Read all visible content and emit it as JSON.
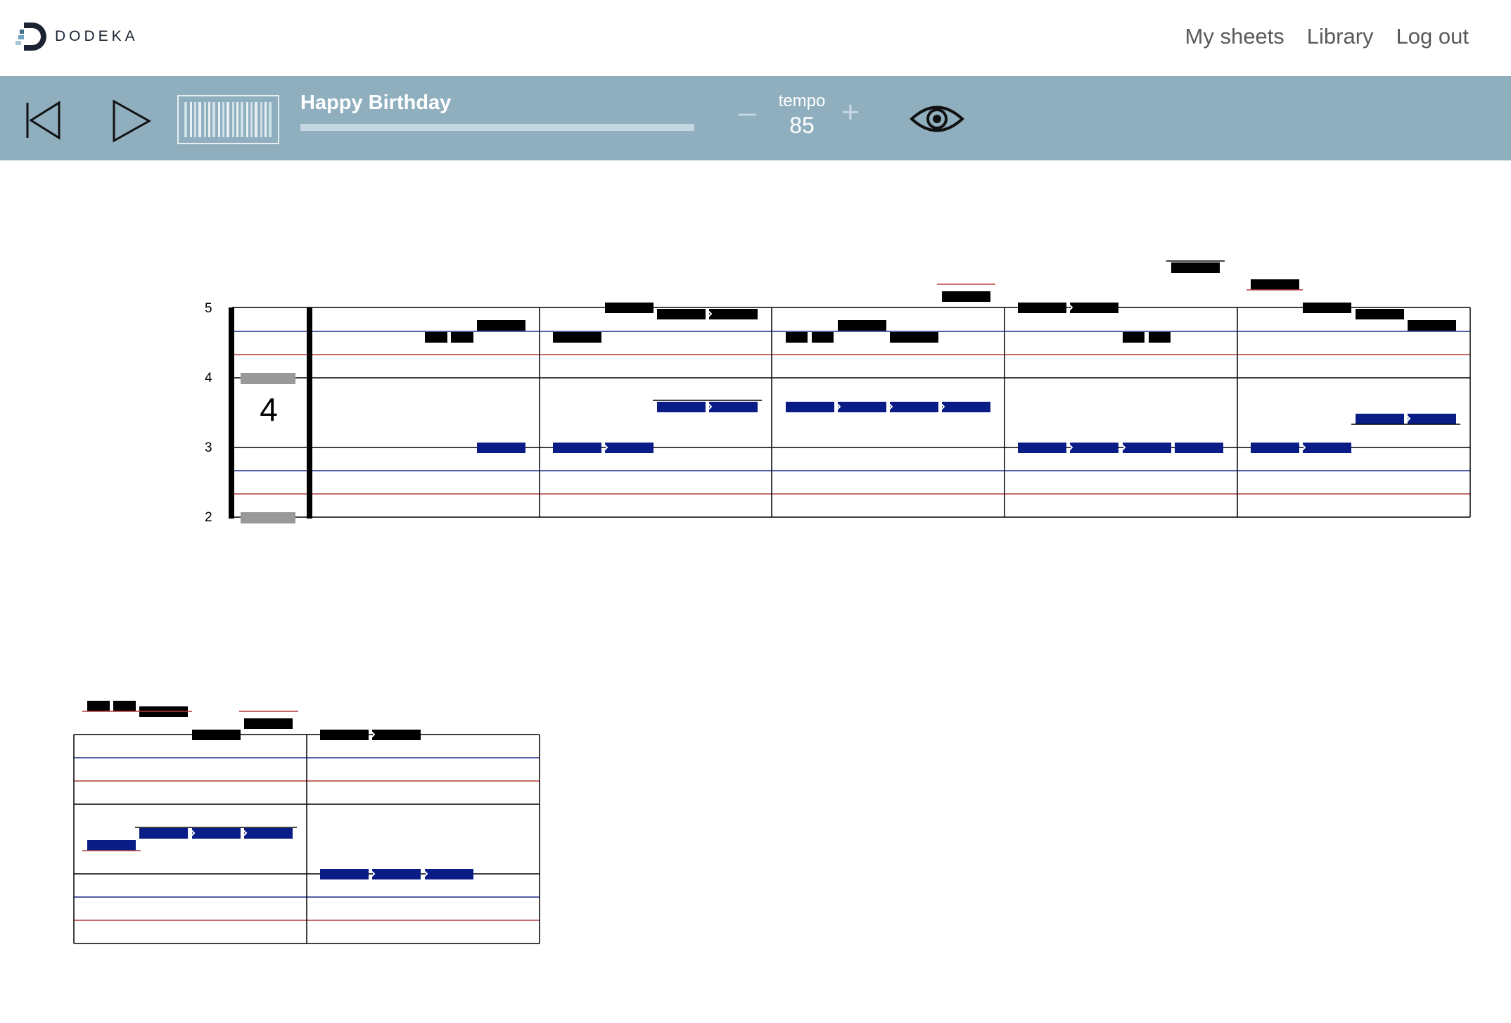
{
  "header": {
    "brand": "DODEKA",
    "nav": [
      "My sheets",
      "Library",
      "Log out"
    ]
  },
  "player": {
    "title": "Happy Birthday",
    "progress": 0.0,
    "tempo_label": "tempo",
    "tempo_value": "85",
    "tempo_minus": "–",
    "tempo_plus": "+"
  },
  "sheet": {
    "octave_labels": [
      "5",
      "4",
      "3",
      "2"
    ],
    "time_signature": "4"
  },
  "colors": {
    "accent": "#8fafbf",
    "melody_note": "#000000",
    "bass_note": "#0a1c86",
    "blue_line": "#1a2a8a",
    "red_line": "#b23a3a"
  }
}
